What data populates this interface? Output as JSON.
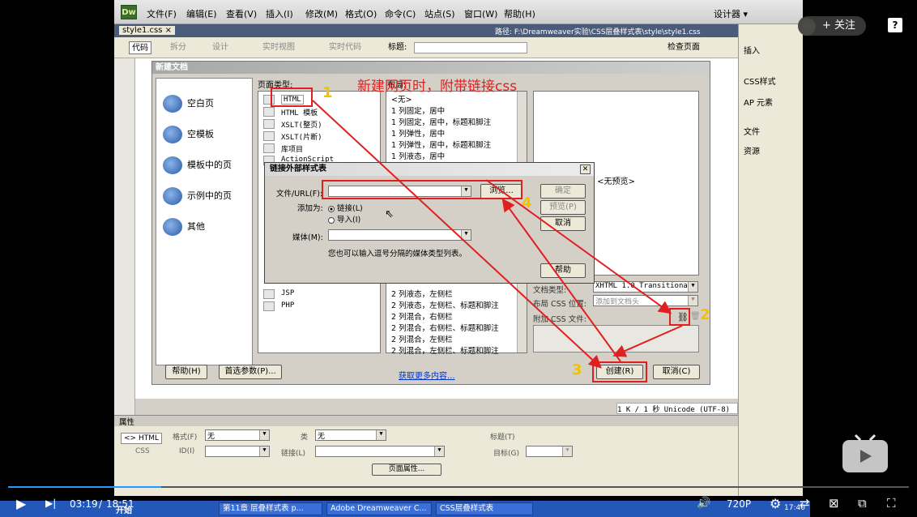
{
  "dw": {
    "logo": "Dw",
    "menus": [
      "文件(F)",
      "编辑(E)",
      "查看(V)",
      "插入(I)",
      "修改(M)",
      "格式(O)",
      "命令(C)",
      "站点(S)",
      "窗口(W)",
      "帮助(H)"
    ],
    "workspace": "设计器 ▾",
    "doc_tab": "style1.css ×",
    "doc_path": "路径: F:\\Dreamweaver实验\\CSS层叠样式表\\style\\style1.css",
    "toolbar": {
      "code": "代码",
      "split": "拆分",
      "design": "设计",
      "live_view": "实时视图",
      "live_code": "实时代码",
      "title_label": "标题:",
      "check_page": "检查页面"
    },
    "right_panel": {
      "insert": "插入",
      "css_styles": "CSS样式",
      "ap_elements": "AP 元素",
      "files": "文件",
      "assets": "资源"
    },
    "status": "1 K / 1 秒  Unicode (UTF-8)"
  },
  "new_doc": {
    "title": "新建文档",
    "categories": [
      "空白页",
      "空模板",
      "模板中的页",
      "示例中的页",
      "其他"
    ],
    "page_type_label": "页面类型:",
    "page_types": [
      "HTML",
      "HTML 模板",
      "XSLT(整页)",
      "XSLT(片断)",
      "库项目",
      "ActionScript",
      "JSP",
      "PHP"
    ],
    "layout_label": "布局:",
    "layouts_top": [
      "<无>",
      "1 列固定，居中",
      "1 列固定，居中，标题和脚注",
      "1 列弹性，居中",
      "1 列弹性，居中，标题和脚注",
      "1 列液态，居中"
    ],
    "layouts_bottom": [
      "2 列液态，左侧栏",
      "2 列液态，左侧栏、标题和脚注",
      "2 列混合，右侧栏",
      "2 列混合，右侧栏、标题和脚注",
      "2 列混合，左侧栏",
      "2 列混合，左侧栏、标题和脚注"
    ],
    "preview_text": "<无预览>",
    "doctype_label": "文档类型:",
    "doctype_value": "XHTML 1.0 Transitional",
    "layout_css_label": "布局 CSS 位置:",
    "layout_css_value": "添加到文档头",
    "attach_css_label": "附加 CSS 文件:",
    "help": "帮助(H)",
    "prefs": "首选参数(P)...",
    "more_content": "获取更多内容...",
    "create": "创建(R)",
    "cancel": "取消(C)"
  },
  "link_dialog": {
    "title": "链接外部样式表",
    "file_url_label": "文件/URL(F):",
    "browse": "浏览...",
    "add_as_label": "添加为:",
    "option_link": "链接(L)",
    "option_import": "导入(I)",
    "media_label": "媒体(M):",
    "hint": "您也可以输入逗号分隔的媒体类型列表。",
    "ok": "确定",
    "preview": "预览(P)",
    "cancel": "取消",
    "help": "帮助"
  },
  "annotation": {
    "note": "新建网页时，附带链接css",
    "n1": "1",
    "n2": "2",
    "n3": "3",
    "n4": "4",
    "color": "#e02020",
    "num_color": "#f2c200"
  },
  "props": {
    "header": "属性",
    "html_tab": "<> HTML",
    "css_tab": "CSS",
    "format_label": "格式(F)",
    "format_value": "无",
    "class_label": "类",
    "class_value": "无",
    "id_label": "ID(I)",
    "link_label": "链接(L)",
    "target_label": "目标(G)",
    "title_label": "标题(T)",
    "page_props": "页面属性..."
  },
  "taskbar": {
    "start": "开始",
    "tasks": [
      "第11章 层叠样式表 p...",
      "Adobe Dreamweaver C...",
      "CSS层叠样式表"
    ],
    "clock": "17:40"
  },
  "player": {
    "time_current": "03:19",
    "time_total": "18:51",
    "quality": "720P",
    "follow": "+ 关注",
    "help_icon": "?",
    "progress": 0.17
  }
}
